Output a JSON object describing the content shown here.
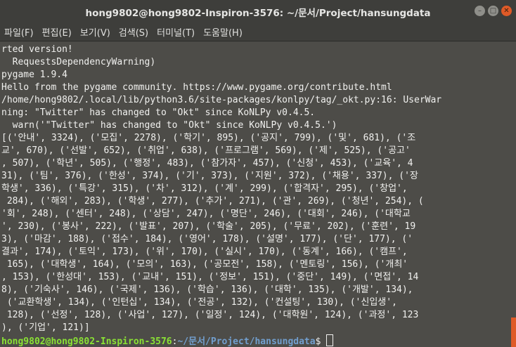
{
  "window": {
    "title": "hong9802@hong9802-Inspiron-3576: ~/문서/Project/hansungdata",
    "controls": {
      "minimize": "–",
      "maximize": "□",
      "close": "✕"
    }
  },
  "menu": [
    "파일(F)",
    "편집(E)",
    "보기(V)",
    "검색(S)",
    "터미널(T)",
    "도움말(H)"
  ],
  "terminal": {
    "lines": [
      "rted version!",
      "  RequestsDependencyWarning)",
      "pygame 1.9.4",
      "Hello from the pygame community. https://www.pygame.org/contribute.html",
      "/home/hong9802/.local/lib/python3.6/site-packages/konlpy/tag/_okt.py:16: UserWar",
      "ning: \"Twitter\" has changed to \"Okt\" since KoNLPy v0.4.5.",
      "  warn('\"Twitter\" has changed to \"Okt\" since KoNLPy v0.4.5.')",
      "[('안내', 3324), ('모집', 2278), ('학기', 895), ('공지', 799), ('및', 681), ('조",
      "교', 670), ('선발', 652), ('취업', 638), ('프로그램', 569), ('제', 525), ('공고'",
      ", 507), ('학년', 505), ('행정', 483), ('참가자', 457), ('신청', 453), ('교육', 4",
      "31), ('팀', 376), ('한성', 374), ('기', 373), ('지원', 372), ('채용', 337), ('장",
      "학생', 336), ('특강', 315), ('차', 312), ('계', 299), ('합격자', 295), ('창업',",
      " 284), ('해외', 283), ('학생', 277), ('추가', 271), ('관', 269), ('청년', 254), (",
      "'회', 248), ('센터', 248), ('상담', 247), ('명단', 246), ('대회', 246), ('대학교",
      "', 230), ('봉사', 222), ('발표', 207), ('학술', 205), ('무료', 202), ('훈련', 19",
      "3), ('마감', 188), ('접수', 184), ('영어', 178), ('설명', 177), ('단', 177), ('",
      "결과', 174), ('토익', 173), ('위', 170), ('실시', 170), ('동계', 166), ('캠프',",
      " 165), ('대학생', 164), ('모의', 163), ('공모전', 158), ('멘토링', 156), ('개최'",
      ", 153), ('한성대', 153), ('교내', 151), ('정보', 151), ('중단', 149), ('면접', 14",
      "8), ('기숙사', 146), ('국제', 136), ('학습', 136), ('대학', 135), ('개발', 134),",
      " ('교환학생', 134), ('인턴십', 134), ('전공', 132), ('컨설팅', 130), ('신입생',",
      " 128), ('선정', 128), ('사업', 127), ('일정', 124), ('대학원', 124), ('과정', 123",
      "), ('기업', 121)]"
    ],
    "prompt_user": "hong9802@hong9802-Inspiron-3576",
    "prompt_sep": ":",
    "prompt_path": "~/문서/Project/hansungdata",
    "prompt_symbol": "$ "
  }
}
